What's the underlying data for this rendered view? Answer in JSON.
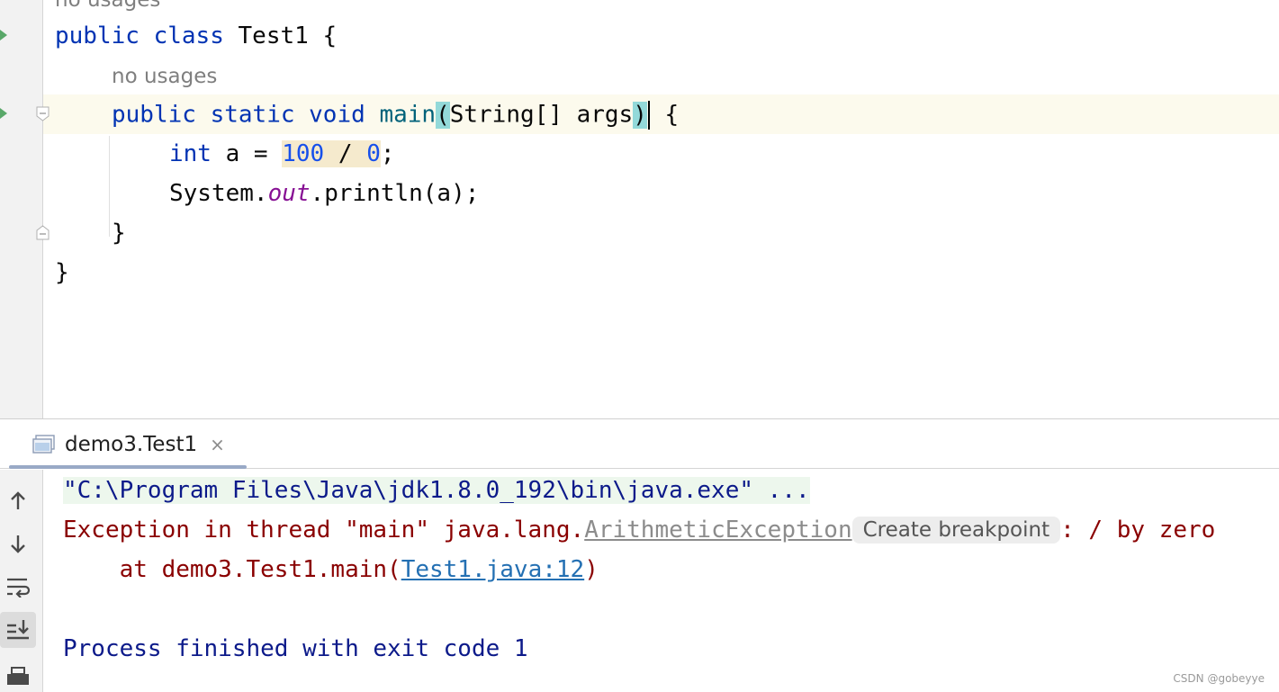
{
  "editor": {
    "usage_hint_top": "no usages",
    "line_class": {
      "kw_public": "public",
      "kw_class": "class",
      "class_name": "Test1",
      "open_brace": "{"
    },
    "usage_hint_method": "no usages",
    "line_main": {
      "kw_public": "public",
      "kw_static": "static",
      "kw_void": "void",
      "method_name": "main",
      "lparen": "(",
      "params": "String[] args",
      "rparen": ")",
      "open_brace": "{"
    },
    "line_int": {
      "kw_int": "int",
      "lhs": "a = ",
      "num1": "100",
      "op": " / ",
      "num2": "0",
      "semi": ";"
    },
    "line_println": {
      "system": "System.",
      "field": "out",
      "call": ".println(a);"
    },
    "close_method": "}",
    "close_class": "}"
  },
  "run_panel": {
    "tab": {
      "label": "demo3.Test1",
      "close": "×"
    },
    "console": {
      "command": "\"C:\\Program Files\\Java\\jdk1.8.0_192\\bin\\java.exe\" ...",
      "exception_prefix": "Exception in thread \"main\" java.lang.",
      "exception_class": "ArithmeticException",
      "breakpoint_chip": "Create breakpoint",
      "exception_suffix": ": / by zero",
      "stack_prefix": "    at demo3.Test1.main(",
      "stack_link": "Test1.java:12",
      "stack_suffix": ")",
      "process_finished": "Process finished with exit code 1"
    },
    "toolbar": [
      "arrow-up-icon",
      "arrow-down-icon",
      "soft-wrap-icon",
      "scroll-to-end-icon",
      "print-icon"
    ]
  },
  "watermark": "CSDN @gobeyye",
  "colors": {
    "keyword": "#0033b3",
    "number": "#1750eb",
    "method": "#00627a",
    "static_field": "#871094",
    "error_text": "#8a0000",
    "link": "#2470b3",
    "run_marker": "#59a869"
  }
}
